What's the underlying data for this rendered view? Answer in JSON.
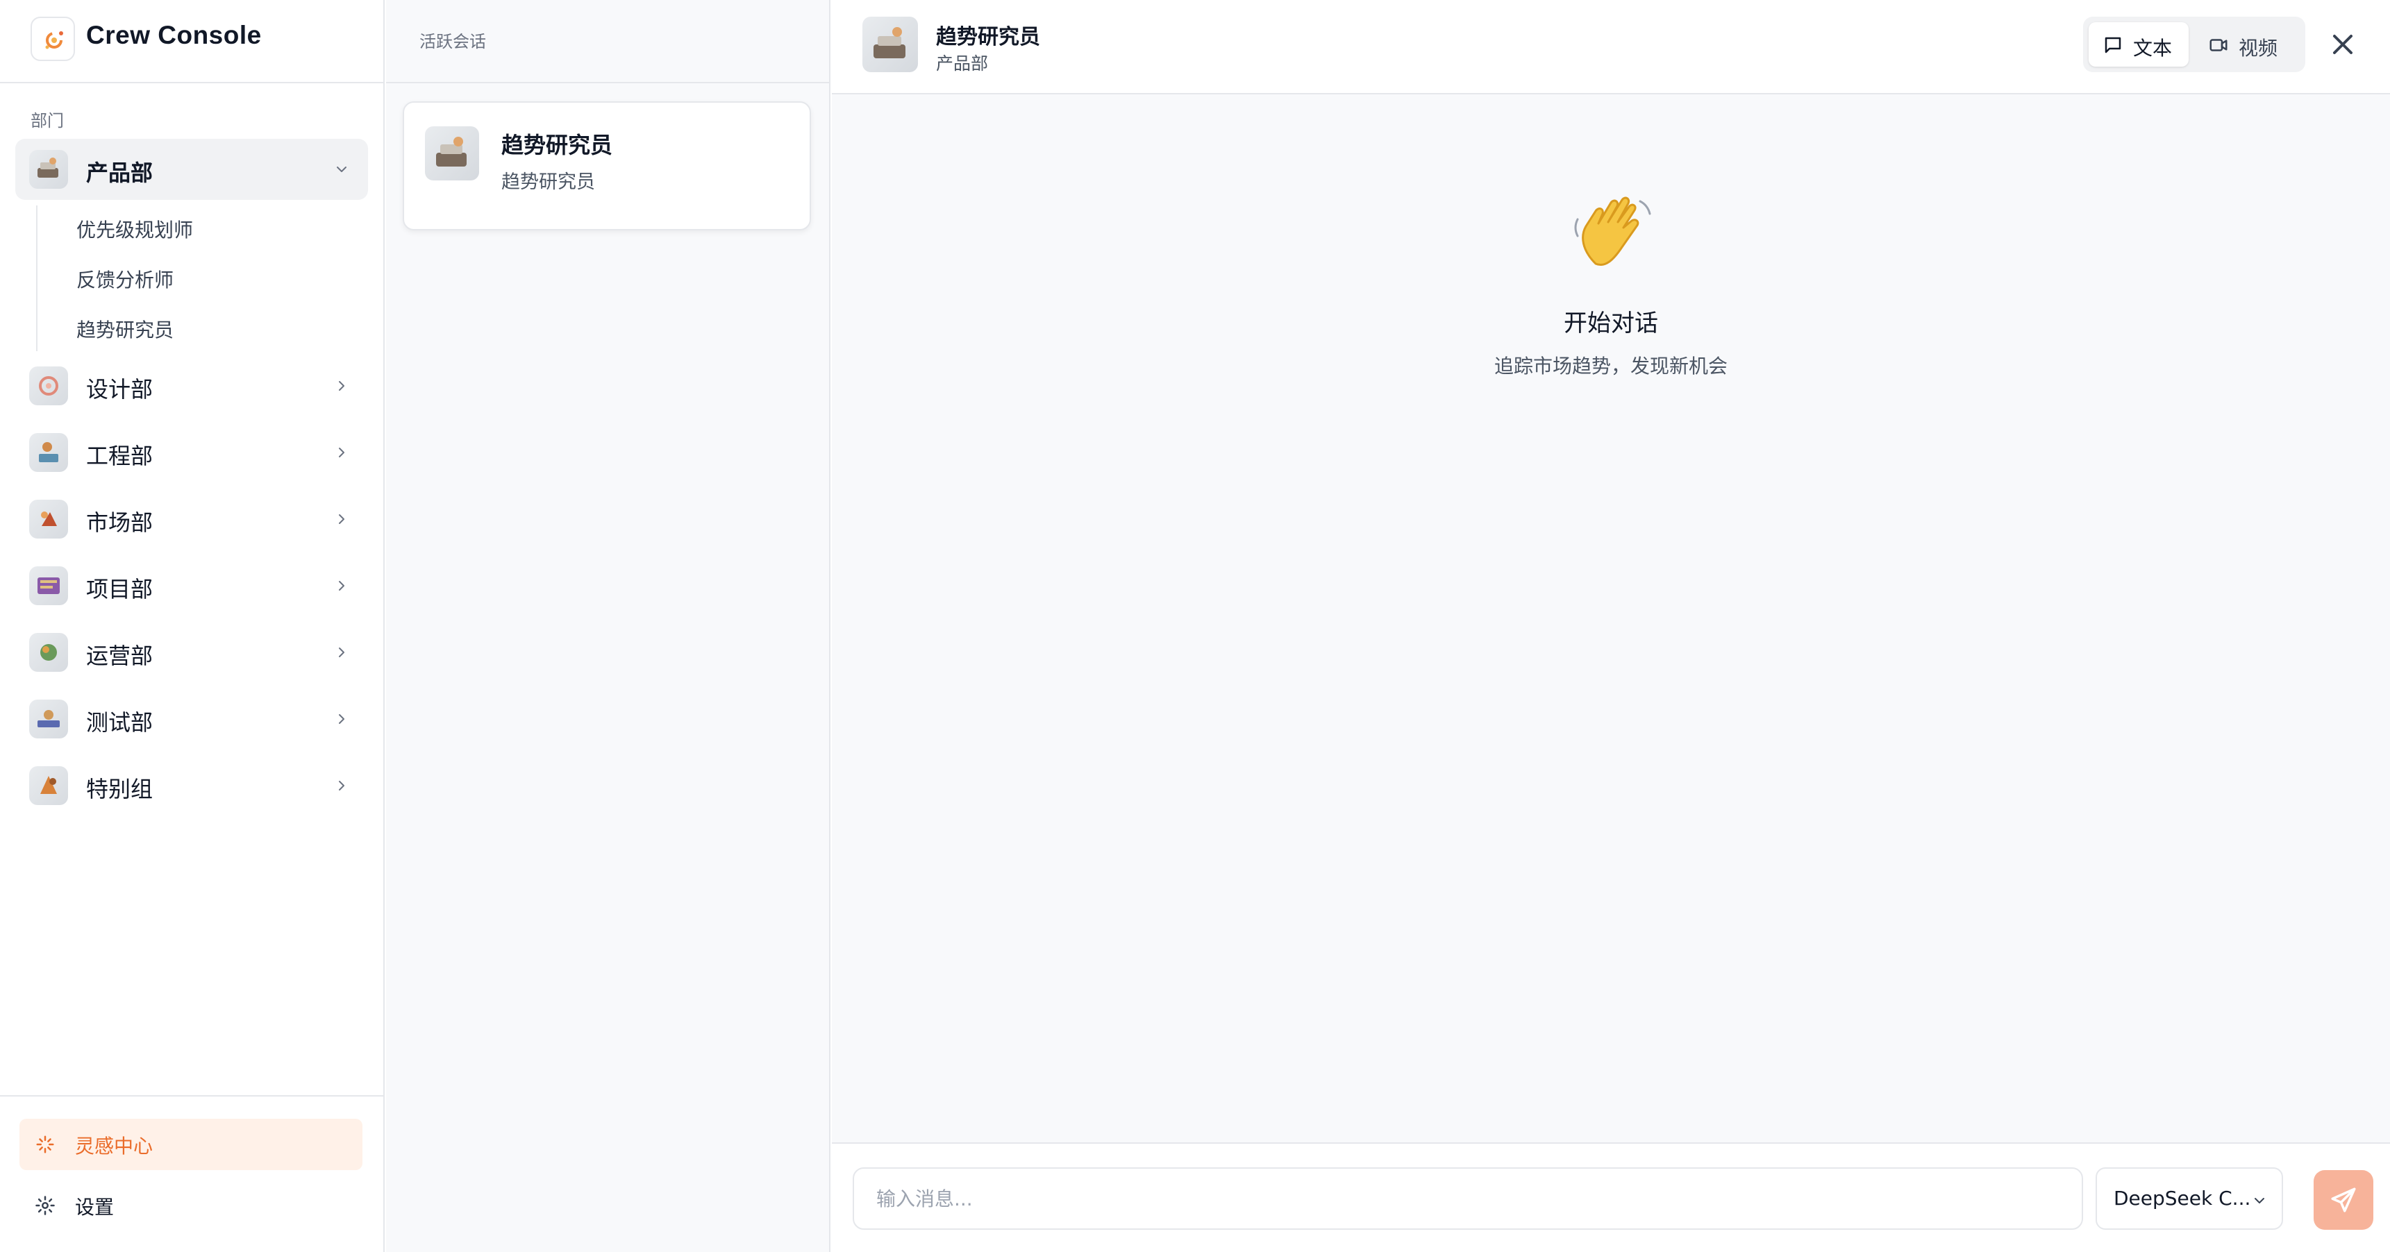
{
  "app": {
    "title": "Crew Console"
  },
  "sidebar": {
    "section_label": "部门",
    "departments": [
      {
        "label": "产品部",
        "expanded": true,
        "members": [
          "优先级规划师",
          "反馈分析师",
          "趋势研究员"
        ]
      },
      {
        "label": "设计部"
      },
      {
        "label": "工程部"
      },
      {
        "label": "市场部"
      },
      {
        "label": "项目部"
      },
      {
        "label": "运营部"
      },
      {
        "label": "测试部"
      },
      {
        "label": "特别组"
      }
    ],
    "inspiration_label": "灵感中心",
    "settings_label": "设置"
  },
  "sessions": {
    "header_label": "活跃会话",
    "items": [
      {
        "title": "趋势研究员",
        "subtitle": "趋势研究员"
      }
    ]
  },
  "chat": {
    "agent_name": "趋势研究员",
    "agent_department": "产品部",
    "modes": {
      "text_label": "文本",
      "video_label": "视频",
      "active": "text"
    },
    "empty_state": {
      "emoji": "👋",
      "title": "开始对话",
      "subtitle": "追踪市场趋势，发现新机会"
    },
    "composer": {
      "placeholder": "输入消息...",
      "model_label": "DeepSeek C..."
    }
  },
  "colors": {
    "accent": "#ea6c2a",
    "accent_bg": "#fff1e8",
    "send_bg": "#f7b39a"
  }
}
